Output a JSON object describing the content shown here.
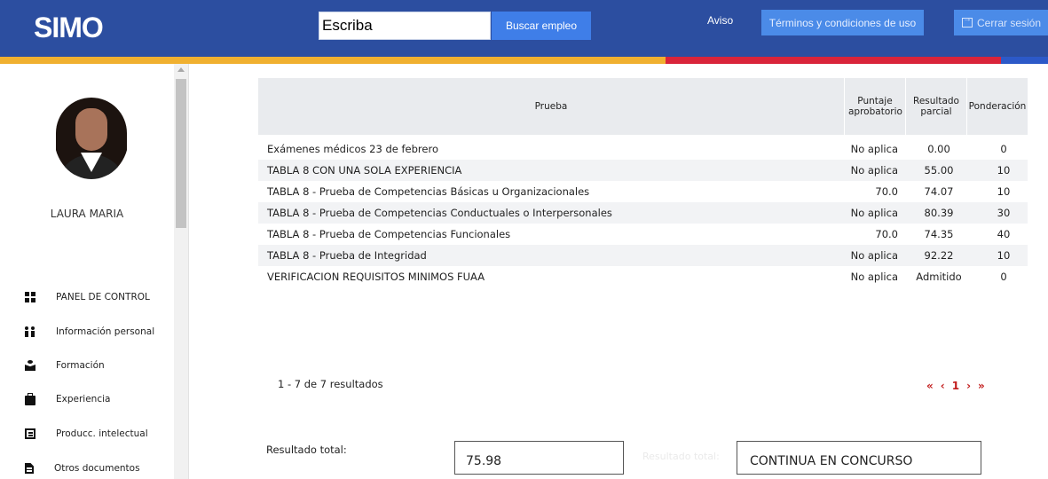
{
  "header": {
    "logo_text": "SIMO",
    "search": {
      "value": "Escriba"
    },
    "search_button": "Buscar empleo",
    "aviso": "Aviso",
    "terms_button": "Términos y condiciones de uso",
    "logout_button": "Cerrar sesión",
    "stripe_colors": [
      "#f0b030",
      "#d9243a",
      "#2c59c8"
    ],
    "bg_color": "#2c4ea0"
  },
  "sidebar": {
    "user_name": "LAURA MARIA",
    "items": [
      {
        "label": "PANEL DE CONTROL",
        "icon": "dashboard-icon"
      },
      {
        "label": "Información personal",
        "icon": "people-icon"
      },
      {
        "label": "Formación",
        "icon": "graduation-icon"
      },
      {
        "label": "Experiencia",
        "icon": "briefcase-icon"
      },
      {
        "label": "Producc. intelectual",
        "icon": "book-icon"
      },
      {
        "label": "Otros documentos",
        "icon": "document-icon"
      }
    ]
  },
  "table": {
    "columns": [
      "Prueba",
      "Puntaje aprobatorio",
      "Resultado parcial",
      "Ponderación"
    ],
    "rows": [
      {
        "prueba": "Exámenes médicos 23 de febrero",
        "puntaje": "No aplica",
        "resultado": "0.00",
        "ponderacion": "0"
      },
      {
        "prueba": "TABLA 8 CON UNA SOLA EXPERIENCIA",
        "puntaje": "No aplica",
        "resultado": "55.00",
        "ponderacion": "10"
      },
      {
        "prueba": "TABLA 8 - Prueba de Competencias Básicas u Organizacionales",
        "puntaje": "70.0",
        "resultado": "74.07",
        "ponderacion": "10"
      },
      {
        "prueba": "TABLA 8 - Prueba de Competencias Conductuales o Interpersonales",
        "puntaje": "No aplica",
        "resultado": "80.39",
        "ponderacion": "30"
      },
      {
        "prueba": "TABLA 8 - Prueba de Competencias Funcionales",
        "puntaje": "70.0",
        "resultado": "74.35",
        "ponderacion": "40"
      },
      {
        "prueba": "TABLA 8 - Prueba de Integridad",
        "puntaje": "No aplica",
        "resultado": "92.22",
        "ponderacion": "10"
      },
      {
        "prueba": "VERIFICACION REQUISITOS MINIMOS FUAA",
        "puntaje": "No aplica",
        "resultado": "Admitido",
        "ponderacion": "0"
      }
    ]
  },
  "pagination": {
    "info": "1 - 7 de 7 resultados",
    "first": "«",
    "prev": "‹",
    "current": "1",
    "next": "›",
    "last": "»"
  },
  "result": {
    "label": "Resultado total:",
    "value": "75.98",
    "label2": "Resultado total:",
    "status": "CONTINUA EN CONCURSO"
  }
}
